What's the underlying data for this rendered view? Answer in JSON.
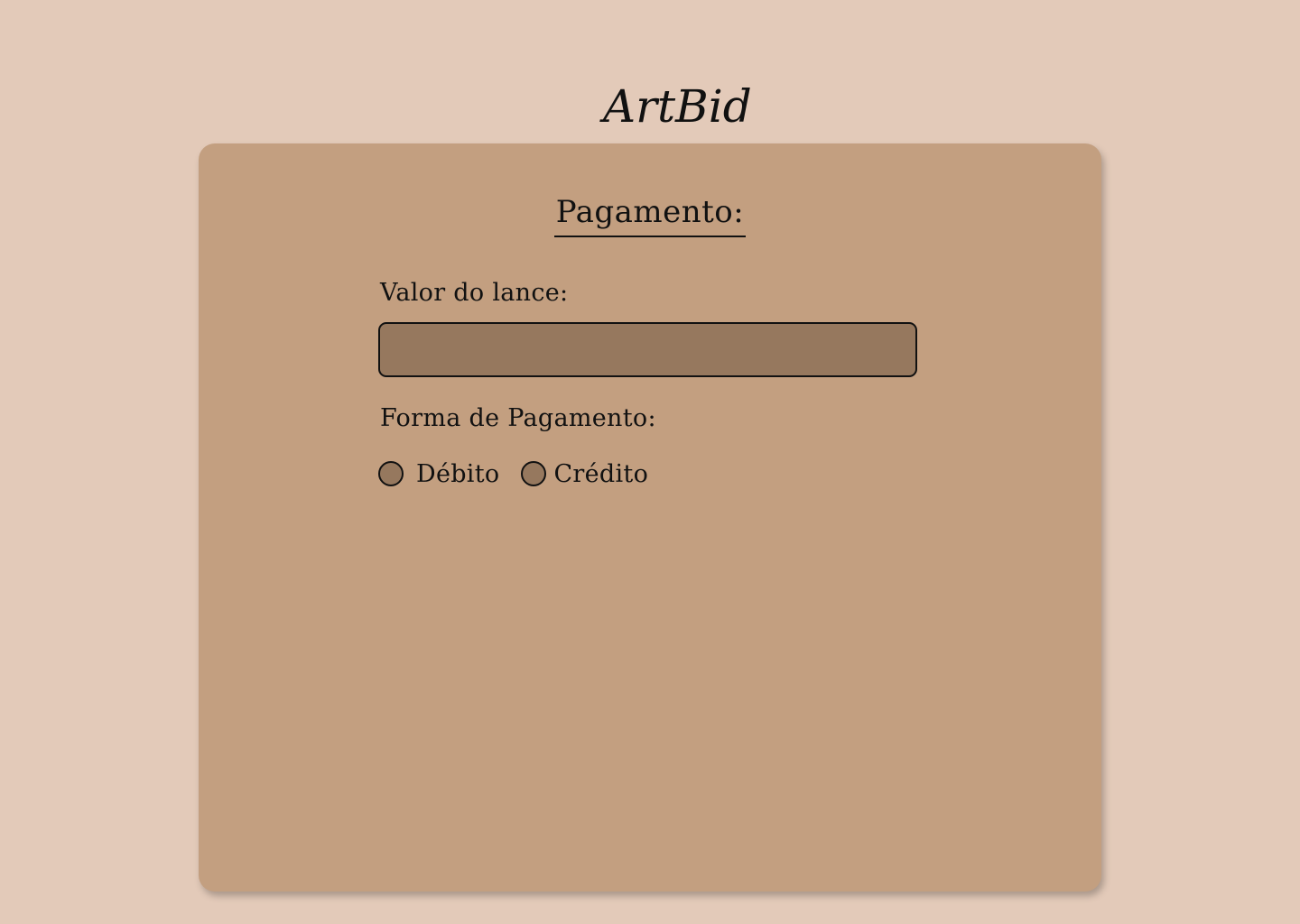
{
  "logo": {
    "text": "ArtBid",
    "part1": "Art",
    "part2": "Bid"
  },
  "payment": {
    "title": "Pagamento:",
    "bid_label": "Valor do lance:",
    "bid_value": "",
    "bid_placeholder": "",
    "method_label": "Forma de Pagamento:",
    "options": [
      {
        "label": "Débito",
        "selected": false
      },
      {
        "label": "Crédito",
        "selected": false
      }
    ]
  },
  "colors": {
    "page_background": "#e3cab9",
    "card_background": "#c39f80",
    "input_fill": "#96785e",
    "text": "#111111"
  }
}
